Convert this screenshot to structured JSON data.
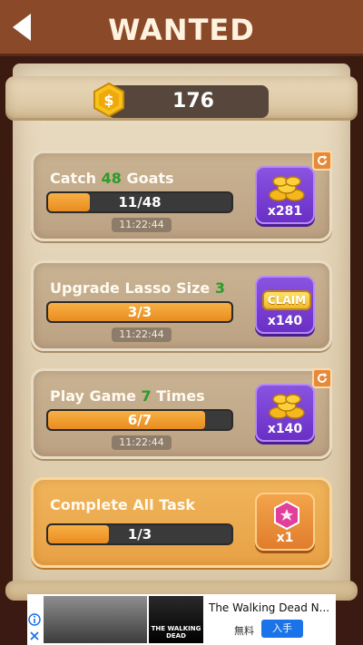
{
  "header": {
    "title": "WANTED"
  },
  "balance": {
    "value": "176"
  },
  "tasks": [
    {
      "title_prefix": "Catch ",
      "title_num": "48",
      "title_suffix": " Goats",
      "progress_text": "11/48",
      "progress_fraction": 0.23,
      "timer": "11:22:44",
      "reward_count": "x281",
      "state": "in-progress"
    },
    {
      "title_prefix": "Upgrade Lasso Size ",
      "title_num": "3",
      "title_suffix": "",
      "progress_text": "3/3",
      "progress_fraction": 1.0,
      "timer": "11:22:44",
      "reward_count": "x140",
      "claim_label": "CLAIM",
      "state": "claimable"
    },
    {
      "title_prefix": "Play Game ",
      "title_num": "7",
      "title_suffix": " Times",
      "progress_text": "6/7",
      "progress_fraction": 0.857,
      "timer": "11:22:44",
      "reward_count": "x140",
      "state": "in-progress"
    },
    {
      "title": "Complete All Task",
      "progress_text": "1/3",
      "progress_fraction": 0.33,
      "reward_count": "x1",
      "state": "in-progress"
    }
  ],
  "icons": {
    "back": "back-arrow-icon",
    "coin": "dollar-coin-icon",
    "coins_reward": "coin-pile-icon",
    "gem_reward": "pink-gem-icon",
    "refresh": "refresh-icon"
  },
  "ad": {
    "title": "The Walking Dead N...",
    "price": "無料",
    "install_label": "入手",
    "logo_text": "THE WALKING DEAD"
  },
  "colors": {
    "header_bg": "#8a4a2a",
    "accent_green": "#2e9a2a",
    "progress_orange": "#f7b044",
    "purple_button": "#7a40d4",
    "orange_button": "#e58a3a"
  }
}
